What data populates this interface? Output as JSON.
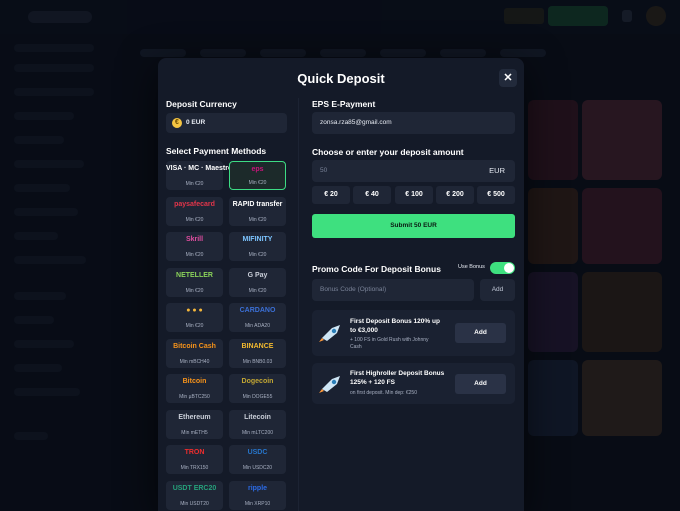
{
  "modal": {
    "title": "Quick Deposit",
    "close_icon": "close-icon",
    "close_glyph": "✕"
  },
  "left": {
    "currency_label": "Deposit Currency",
    "currency_value": "0 EUR",
    "currency_icon": "euro-coin-icon",
    "currency_glyph": "€",
    "methods_label": "Select Payment Methods",
    "methods": [
      {
        "name": "VISA · MC · Maestro",
        "min": "Min €20",
        "color": "#ffffff",
        "selected": false
      },
      {
        "name": "eps",
        "min": "Min €20",
        "color": "#c8157a",
        "selected": true
      },
      {
        "name": "paysafecard",
        "min": "Min €20",
        "color": "#e2354a",
        "selected": false
      },
      {
        "name": "RAPID transfer",
        "min": "Min €20",
        "color": "#ffffff",
        "selected": false
      },
      {
        "name": "Skrill",
        "min": "Min €20",
        "color": "#e04ea0",
        "selected": false
      },
      {
        "name": "MIFINITY",
        "min": "Min €20",
        "color": "#7cc4ff",
        "selected": false
      },
      {
        "name": "NETELLER",
        "min": "Min €20",
        "color": "#8bd35a",
        "selected": false
      },
      {
        "name": "G Pay",
        "min": "Min €20",
        "color": "#c9ced8",
        "selected": false
      },
      {
        "name": "● ● ●",
        "min": "Min €20",
        "color": "#f5b73b",
        "selected": false
      },
      {
        "name": "CARDANO",
        "min": "Min ADA20",
        "color": "#3b6fd6",
        "selected": false
      },
      {
        "name": "Bitcoin Cash",
        "min": "Min mBCH40",
        "color": "#f7931a",
        "selected": false
      },
      {
        "name": "BINANCE",
        "min": "Min BNB0.03",
        "color": "#f3ba2f",
        "selected": false
      },
      {
        "name": "Bitcoin",
        "min": "Min µBTC250",
        "color": "#f7931a",
        "selected": false
      },
      {
        "name": "Dogecoin",
        "min": "Min DOGE55",
        "color": "#c2a633",
        "selected": false
      },
      {
        "name": "Ethereum",
        "min": "Min mETH5",
        "color": "#c9ced8",
        "selected": false
      },
      {
        "name": "Litecoin",
        "min": "Min mLTC200",
        "color": "#c9ced8",
        "selected": false
      },
      {
        "name": "TRON",
        "min": "Min TRX150",
        "color": "#ef2d2d",
        "selected": false
      },
      {
        "name": "USDC",
        "min": "Min USDC20",
        "color": "#2775ca",
        "selected": false
      },
      {
        "name": "USDT ERC20",
        "min": "Min USDT20",
        "color": "#26a17b",
        "selected": false
      },
      {
        "name": "ripple",
        "min": "Min XRP10",
        "color": "#2b6be6",
        "selected": false
      }
    ]
  },
  "right": {
    "method_label": "EPS E-Payment",
    "email_value": "zonsa.rza85@gmail.com",
    "amount_label": "Choose or enter your deposit amount",
    "amount_placeholder": "50",
    "amount_currency": "EUR",
    "amounts": [
      "€ 20",
      "€ 40",
      "€ 100",
      "€ 200",
      "€ 500"
    ],
    "submit_label": "Submit 50 EUR",
    "promo_label": "Promo Code For Deposit Bonus",
    "use_bonus_label": "Use Bonus",
    "use_bonus_on": true,
    "bonus_code_placeholder": "Bonus Code (Optional)",
    "add_code_label": "Add",
    "bonuses": [
      {
        "icon": "rocket-icon",
        "title_1": "First Deposit Bonus 120% up",
        "title_2": "to €3,000",
        "sub_1": "+ 100 FS in Gold Rush with Johnny",
        "sub_2": "Cash",
        "add_label": "Add"
      },
      {
        "icon": "rocket-icon",
        "title_1": "First Highroller Deposit Bonus",
        "title_2": "125% + 120 FS",
        "sub_1": "on first deposit. Min dep: €250",
        "add_label": "Add"
      }
    ]
  }
}
